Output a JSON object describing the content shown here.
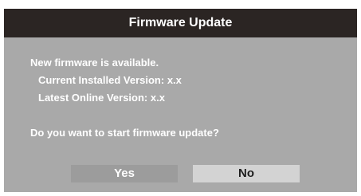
{
  "dialog": {
    "title": "Firmware Update",
    "message": "New firmware is available.",
    "current_version": "Current Installed Version: x.x",
    "latest_version": "Latest Online Version: x.x",
    "question": "Do you want to start firmware update?",
    "yes_label": "Yes",
    "no_label": "No"
  },
  "colors": {
    "title_bar": "#2b2523",
    "dialog_bg": "#a9a9a9",
    "yes_button": "#9c9c9c",
    "no_button": "#d3d3d3",
    "text": "#ffffff"
  }
}
